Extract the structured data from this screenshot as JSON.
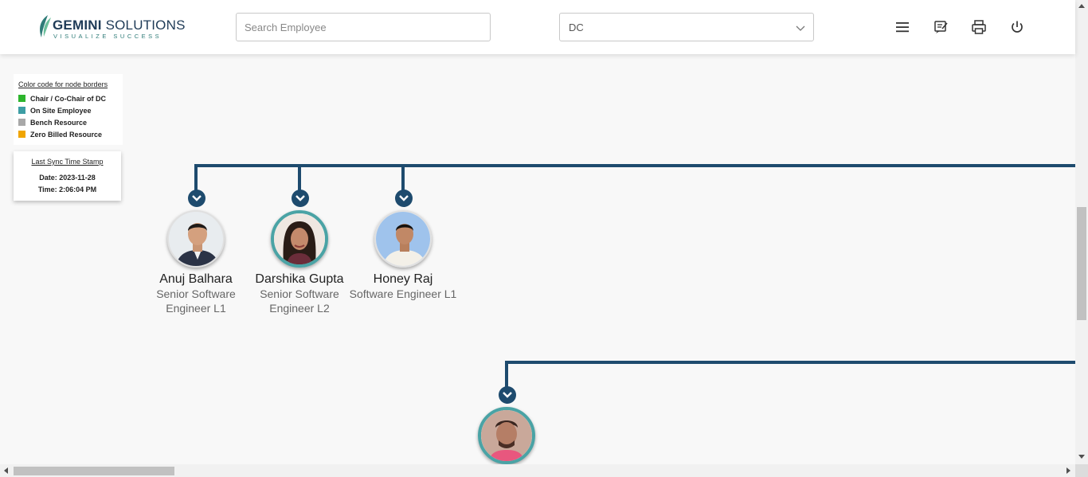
{
  "header": {
    "logo": {
      "name_bold": "GEMINI",
      "name_rest": " SOLUTIONS",
      "tagline": "VISUALIZE SUCCESS",
      "accent": "#2f7c78"
    },
    "search": {
      "placeholder": "Search Employee",
      "value": ""
    },
    "dc_select": {
      "value": "DC"
    },
    "icons": [
      "menu-icon",
      "notes-icon",
      "print-icon",
      "power-icon"
    ]
  },
  "legend": {
    "title": "Color code for node borders",
    "items": [
      {
        "label": "Chair / Co-Chair of DC",
        "color": "#2db52d"
      },
      {
        "label": "On Site Employee",
        "color": "#3d9ea4"
      },
      {
        "label": "Bench Resource",
        "color": "#a8a8a8"
      },
      {
        "label": "Zero Billed Resource",
        "color": "#f0a500"
      }
    ]
  },
  "sync": {
    "title": "Last Sync Time Stamp",
    "date": "Date: 2023-11-28",
    "time": "Time: 2:06:04 PM"
  },
  "tree": {
    "connector_color": "#1e4b6e",
    "nodes": [
      {
        "name": "Anuj Balhara",
        "role": "Senior Software Engineer L1",
        "border": "default"
      },
      {
        "name": "Darshika Gupta",
        "role": "Senior Software Engineer L2",
        "border": "onsite"
      },
      {
        "name": "Honey Raj",
        "role": "Software Engineer L1",
        "border": "default"
      },
      {
        "name": "",
        "role": "",
        "border": "onsite"
      }
    ]
  }
}
